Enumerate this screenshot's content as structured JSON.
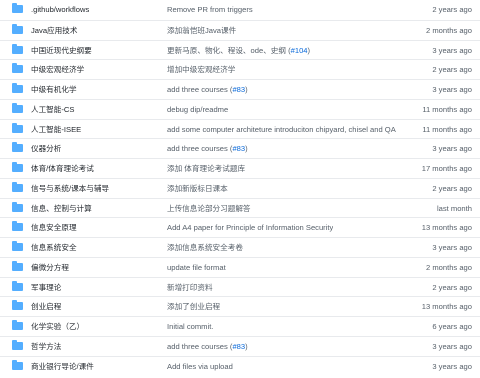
{
  "rows": [
    {
      "name": ".github/workflows",
      "icon": "folder-icon",
      "msg": "Remove PR from triggers",
      "link": "",
      "suffix": "",
      "age": "2 years ago"
    },
    {
      "name": "Java应用技术",
      "icon": "folder-icon",
      "msg": "添加翁恺班Java课件",
      "link": "",
      "suffix": "",
      "age": "2 months ago"
    },
    {
      "name": "中国近现代史纲要",
      "icon": "folder-icon",
      "msg": "更新马原、物化、程设、ode、史纲 (",
      "link": "#104",
      "suffix": ")",
      "age": "3 years ago"
    },
    {
      "name": "中级宏观经济学",
      "icon": "folder-icon",
      "msg": "增加中级宏观经济学",
      "link": "",
      "suffix": "",
      "age": "2 years ago"
    },
    {
      "name": "中级有机化学",
      "icon": "folder-icon",
      "msg": "add three courses (",
      "link": "#83",
      "suffix": ")",
      "age": "3 years ago"
    },
    {
      "name": "人工智能-CS",
      "icon": "folder-icon",
      "msg": "debug dip/readme",
      "link": "",
      "suffix": "",
      "age": "11 months ago"
    },
    {
      "name": "人工智能-ISEE",
      "icon": "folder-icon",
      "msg": "add some computer architeture introduciton chipyard, chisel and QA",
      "link": "",
      "suffix": "",
      "age": "11 months ago"
    },
    {
      "name": "仪器分析",
      "icon": "folder-icon",
      "msg": "add three courses (",
      "link": "#83",
      "suffix": ")",
      "age": "3 years ago"
    },
    {
      "name": "体育/体育理论考试",
      "icon": "folder-icon",
      "msg": "添加 体育理论考试题库",
      "link": "",
      "suffix": "",
      "age": "17 months ago"
    },
    {
      "name": "信号与系统/课本与辅导",
      "icon": "folder-icon",
      "msg": "添加新版标日课本",
      "link": "",
      "suffix": "",
      "age": "2 years ago"
    },
    {
      "name": "信息、控制与计算",
      "icon": "folder-icon",
      "msg": "上传信息论部分习题解答",
      "link": "",
      "suffix": "",
      "age": "last month"
    },
    {
      "name": "信息安全原理",
      "icon": "folder-icon",
      "msg": "Add A4 paper for Principle of Information Security",
      "link": "",
      "suffix": "",
      "age": "13 months ago"
    },
    {
      "name": "信息系统安全",
      "icon": "folder-icon",
      "msg": "添加信息系统安全考卷",
      "link": "",
      "suffix": "",
      "age": "3 years ago"
    },
    {
      "name": "偏微分方程",
      "icon": "folder-icon",
      "msg": "update file format",
      "link": "",
      "suffix": "",
      "age": "2 months ago"
    },
    {
      "name": "军事理论",
      "icon": "folder-icon",
      "msg": "新增打印资料",
      "link": "",
      "suffix": "",
      "age": "2 years ago"
    },
    {
      "name": "创业启程",
      "icon": "folder-icon",
      "msg": "添加了创业启程",
      "link": "",
      "suffix": "",
      "age": "13 months ago"
    },
    {
      "name": "化学实验（乙）",
      "icon": "folder-icon",
      "msg": "Initial commit.",
      "link": "",
      "suffix": "",
      "age": "6 years ago"
    },
    {
      "name": "哲学方法",
      "icon": "folder-icon",
      "msg": "add three courses (",
      "link": "#83",
      "suffix": ")",
      "age": "3 years ago"
    },
    {
      "name": "商业银行导论/课件",
      "icon": "folder-icon",
      "msg": "Add files via upload",
      "link": "",
      "suffix": "",
      "age": "3 years ago"
    }
  ]
}
